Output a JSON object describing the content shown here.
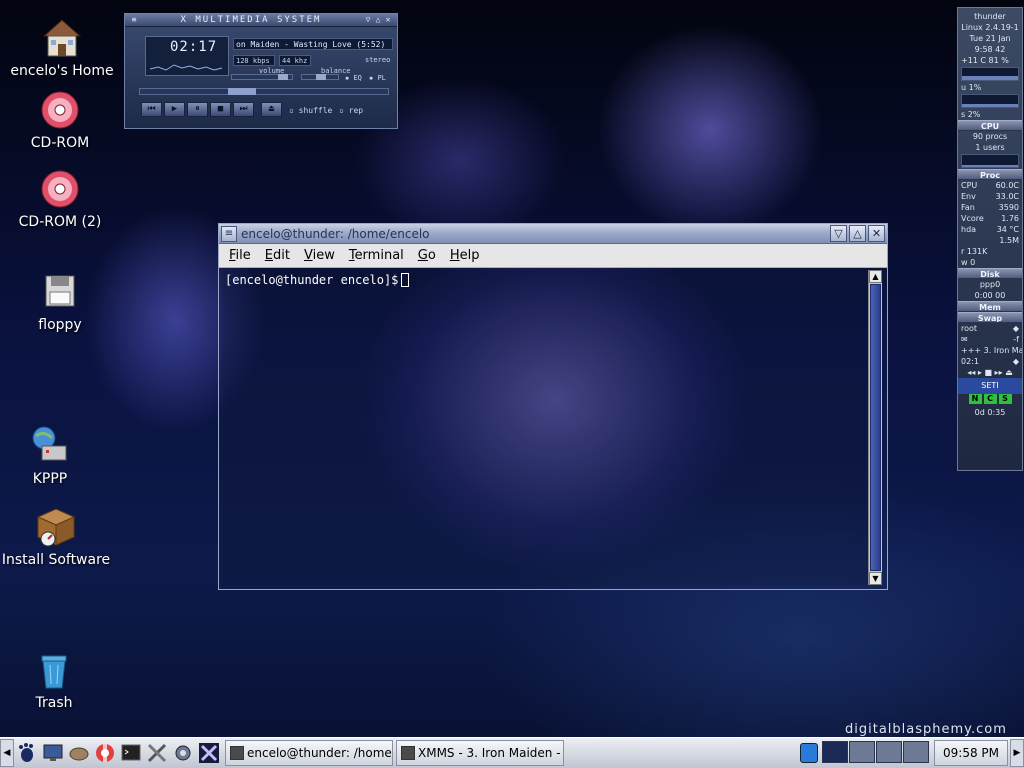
{
  "desktop": {
    "icons": [
      {
        "label": "encelo's Home",
        "icon": "home-icon"
      },
      {
        "label": "CD-ROM",
        "icon": "cdrom-icon"
      },
      {
        "label": "CD-ROM (2)",
        "icon": "cdrom-icon"
      },
      {
        "label": "floppy",
        "icon": "floppy-icon"
      },
      {
        "label": "KPPP",
        "icon": "kppp-icon"
      },
      {
        "label": "Install Software",
        "icon": "install-software-icon"
      },
      {
        "label": "Trash",
        "icon": "trash-icon"
      }
    ],
    "watermark": "digitalblasphemy.com"
  },
  "xmms": {
    "title": "X MULTIMEDIA SYSTEM",
    "time": "02:17",
    "song": "on Maiden - Wasting Love (5:52)",
    "kbps": "128",
    "kbps_unit": "kbps",
    "khz": "44",
    "khz_unit": "khz",
    "stereo": "stereo",
    "volume_label": "volume",
    "balance_label": "balance",
    "eq": "EQ",
    "pl": "PL",
    "shuffle": "shuffle",
    "rep": "rep"
  },
  "terminal": {
    "title": "encelo@thunder: /home/encelo",
    "menu": {
      "file": {
        "first": "F",
        "rest": "ile"
      },
      "edit": {
        "first": "E",
        "rest": "dit"
      },
      "view": {
        "first": "V",
        "rest": "iew"
      },
      "terminal": {
        "first": "T",
        "rest": "erminal"
      },
      "go": {
        "first": "G",
        "rest": "o"
      },
      "help": {
        "first": "H",
        "rest": "elp"
      }
    },
    "prompt": "[encelo@thunder encelo]$"
  },
  "gkrellm": {
    "hostname": "thunder",
    "kernel": "Linux 2.4.19-1",
    "date": "Tue 21 Jan",
    "clock": "9:58  42",
    "temp_pct": "+11 C   81 %",
    "cpu_pct": "u 1%",
    "sys_pct": "s 2%",
    "cpu_label": "CPU",
    "procs": "90 procs",
    "users": "1 users",
    "proc_label": "Proc",
    "sensor_cpu_label": "CPU",
    "sensor_cpu_val": "60.0C",
    "sensor_env_label": "Env",
    "sensor_env_val": "33.0C",
    "fan_label": "Fan",
    "fan_val": "3590",
    "vcore_label": "Vcore",
    "vcore_val": "1.76",
    "hda_label": "hda",
    "hda_val": "34 °C",
    "disk_total": "1.5M",
    "disk_r": "r  131K",
    "disk_w": "w  0",
    "disk_label": "Disk",
    "ppp_label": "ppp0",
    "ppp_time": "0:00 00",
    "mem_label": "Mem",
    "swap_label": "Swap",
    "user_root": "root",
    "mail_count": "-f",
    "track": "+++ 3. Iron Ma",
    "track_time": "02:1",
    "seti_label": "SETI",
    "seti_n": "N",
    "seti_c": "C",
    "seti_s": "S",
    "seti_time": "0d 0:35"
  },
  "panel": {
    "tasks": [
      {
        "label": "encelo@thunder: /home/e"
      },
      {
        "label": "XMMS - 3. Iron Maiden -"
      }
    ],
    "clock": "09:58 PM",
    "colors": {
      "panel_bg": "#d8dce6",
      "active_ws": "#1a2a55"
    }
  }
}
